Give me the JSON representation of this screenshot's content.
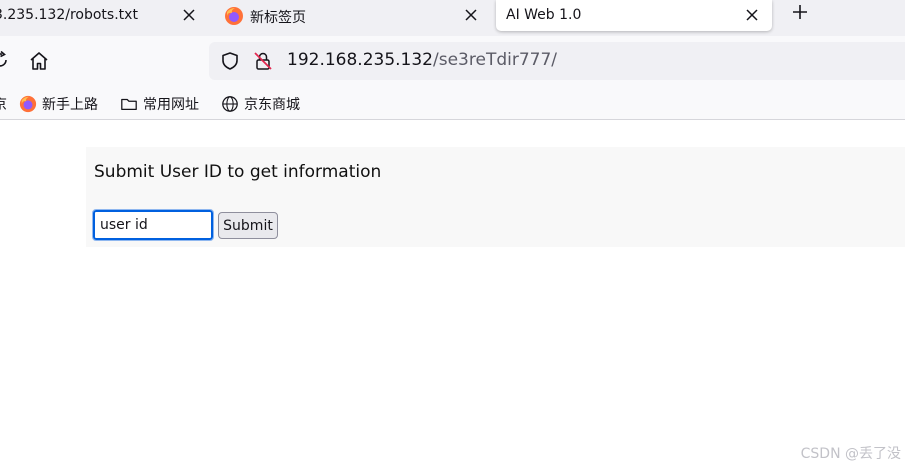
{
  "tabs": [
    {
      "title": "3.235.132/robots.txt",
      "active": false,
      "favicon": "none"
    },
    {
      "title": "新标签页",
      "active": false,
      "favicon": "firefox-icon"
    },
    {
      "title": "AI Web 1.0",
      "active": true,
      "favicon": "none"
    }
  ],
  "navbar": {
    "url_host": "192.168.235.132",
    "url_path": "/se3reTdir777/"
  },
  "bookmarks": [
    {
      "label": "京",
      "icon": "none"
    },
    {
      "label": "新手上路",
      "icon": "firefox-icon"
    },
    {
      "label": "常用网址",
      "icon": "folder-icon"
    },
    {
      "label": "京东商城",
      "icon": "globe-icon"
    }
  ],
  "page": {
    "heading": "Submit User ID to get information",
    "input_value": "user id",
    "submit_label": "Submit"
  },
  "watermark": "CSDN @丢了没",
  "colors": {
    "tabstrip_bg": "#f0f0f4",
    "toolbar_bg": "#f9f9fb",
    "focus_ring": "#0060df",
    "panel_bg": "#f8f8f8"
  }
}
